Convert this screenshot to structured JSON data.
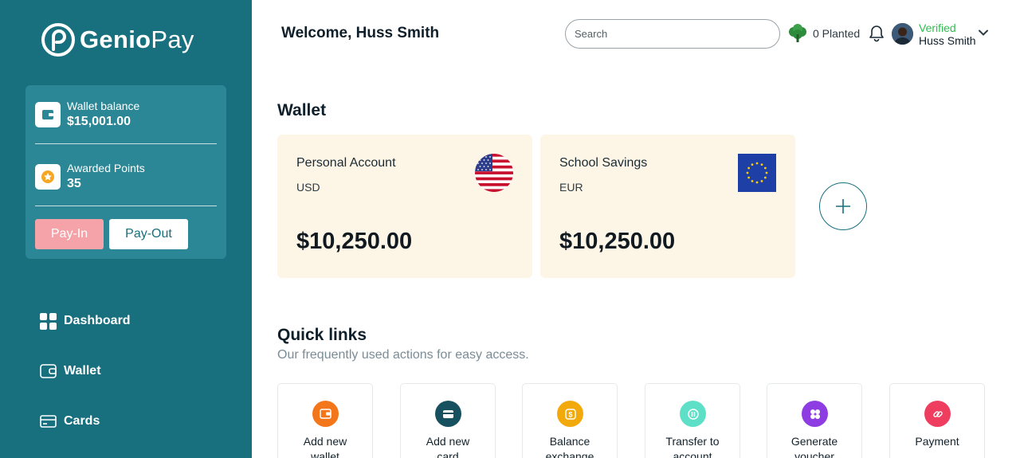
{
  "brand": {
    "name_bold": "Genio",
    "name_light": "Pay"
  },
  "sidebar": {
    "wallet_balance_label": "Wallet balance",
    "wallet_balance_value": "$15,001.00",
    "points_label": "Awarded Points",
    "points_value": "35",
    "payin_label": "Pay-In",
    "payout_label": "Pay-Out",
    "nav": [
      {
        "label": "Dashboard",
        "icon": "grid-icon"
      },
      {
        "label": "Wallet",
        "icon": "wallet-icon"
      },
      {
        "label": "Cards",
        "icon": "card-icon"
      }
    ]
  },
  "header": {
    "welcome": "Welcome, Huss Smith",
    "search_placeholder": "Search",
    "planted": "0 Planted",
    "verified": "Verified",
    "user_name": "Huss Smith"
  },
  "wallet": {
    "title": "Wallet",
    "accounts": [
      {
        "name": "Personal Account",
        "currency": "USD",
        "amount": "$10,250.00",
        "flag": "us-flag-icon"
      },
      {
        "name": "School Savings",
        "currency": "EUR",
        "amount": "$10,250.00",
        "flag": "eu-flag-icon"
      }
    ]
  },
  "quick_links": {
    "title": "Quick links",
    "subtitle": "Our frequently used actions for easy access.",
    "items": [
      {
        "line1": "Add new",
        "line2": "wallet",
        "color": "#f4761b"
      },
      {
        "line1": "Add new",
        "line2": "card",
        "color": "#17505e"
      },
      {
        "line1": "Balance",
        "line2": "exchange",
        "color": "#f2a90c"
      },
      {
        "line1": "Transfer to",
        "line2": "account",
        "color": "#5ee0c8"
      },
      {
        "line1": "Generate",
        "line2": "voucher",
        "color": "#8e3de3"
      },
      {
        "line1": "Payment",
        "line2": "",
        "color": "#ee3d5e"
      }
    ]
  },
  "colors": {
    "sidebar": "#18707f",
    "card_panel": "#2b8795",
    "payin": "#f5a3a8",
    "wallet_card": "#fdf5e6",
    "verified": "#2fbd4f"
  }
}
